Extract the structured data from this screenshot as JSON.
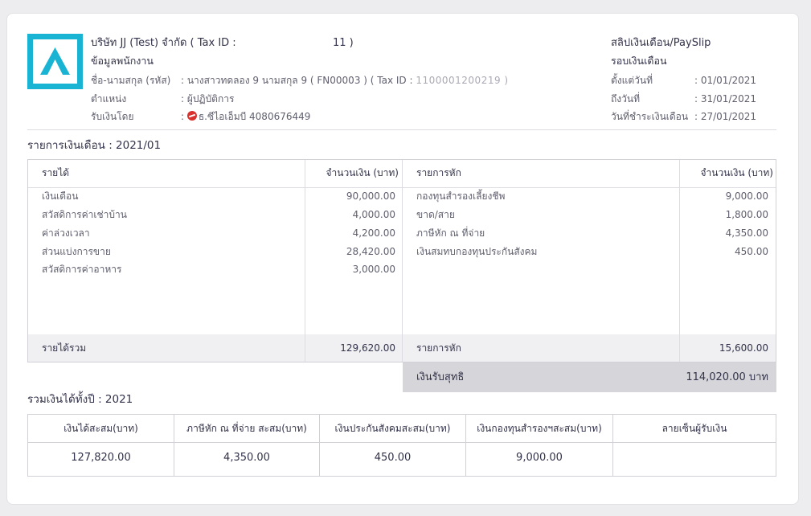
{
  "company": {
    "name_line": "บริษัท JJ (Test) จำกัด ( Tax ID :",
    "tax_id_tail": "11 )",
    "logo": "company-logo-a"
  },
  "employee": {
    "section_title": "ข้อมูลพนักงาน",
    "name_label": "ชื่อ-นามสกุล (รหัส)",
    "name_value": ": นางสาวทดลอง 9 นามสกุล 9 ( FN00003 ) ( Tax ID :",
    "tax_id_masked": "1100001200219 )",
    "position_label": "ตำแหน่ง",
    "position_value": ": ผู้ปฏิบัติการ",
    "paid_by_label": "รับเงินโดย",
    "paid_by_value": "ธ.ซีไอเอ็มบี 4080676449",
    "bank_icon": "cimb-bank-icon"
  },
  "payslip": {
    "title": "สลิปเงินเดือน/PaySlip",
    "period_title": "รอบเงินเดือน",
    "from_label": "ตั้งแต่วันที่",
    "from_value": ": 01/01/2021",
    "to_label": "ถึงวันที่",
    "to_value": ": 31/01/2021",
    "pay_date_label": "วันที่ชำระเงินเดือน",
    "pay_date_value": ": 27/01/2021"
  },
  "salary_section_title": "รายการเงินเดือน : 2021/01",
  "income": {
    "header": "รายได้",
    "amount_header": "จำนวนเงิน (บาท)",
    "items": [
      {
        "label": "เงินเดือน",
        "amount": "90,000.00"
      },
      {
        "label": "สวัสดิการค่าเช่าบ้าน",
        "amount": "4,000.00"
      },
      {
        "label": "ค่าล่วงเวลา",
        "amount": "4,200.00"
      },
      {
        "label": "ส่วนแบ่งการขาย",
        "amount": "28,420.00"
      },
      {
        "label": "สวัสดิการค่าอาหาร",
        "amount": "3,000.00"
      }
    ],
    "total_label": "รายได้รวม",
    "total_value": "129,620.00"
  },
  "deduction": {
    "header": "รายการหัก",
    "amount_header": "จำนวนเงิน (บาท)",
    "items": [
      {
        "label": "กองทุนสำรองเลี้ยงชีพ",
        "amount": "9,000.00"
      },
      {
        "label": "ขาด/สาย",
        "amount": "1,800.00"
      },
      {
        "label": "ภาษีหัก ณ ที่จ่าย",
        "amount": "4,350.00"
      },
      {
        "label": "เงินสมทบกองทุนประกันสังคม",
        "amount": "450.00"
      }
    ],
    "total_label": "รายการหัก",
    "total_value": "15,600.00"
  },
  "net": {
    "label": "เงินรับสุทธิ",
    "value": "114,020.00 บาท"
  },
  "ytd": {
    "title": "รวมเงินได้ทั้งปี : 2021",
    "headers": [
      "เงินได้สะสม(บาท)",
      "ภาษีหัก ณ ที่จ่าย สะสม(บาท)",
      "เงินประกันสังคมสะสม(บาท)",
      "เงินกองทุนสำรองฯสะสม(บาท)",
      "ลายเซ็นผู้รับเงิน"
    ],
    "values": [
      "127,820.00",
      "4,350.00",
      "450.00",
      "9,000.00",
      ""
    ]
  },
  "colors": {
    "logo": "#19b3d4",
    "bank_icon": "#d9322e",
    "net_shade": "#d6d6da",
    "total_shade": "#f0f0f2"
  }
}
